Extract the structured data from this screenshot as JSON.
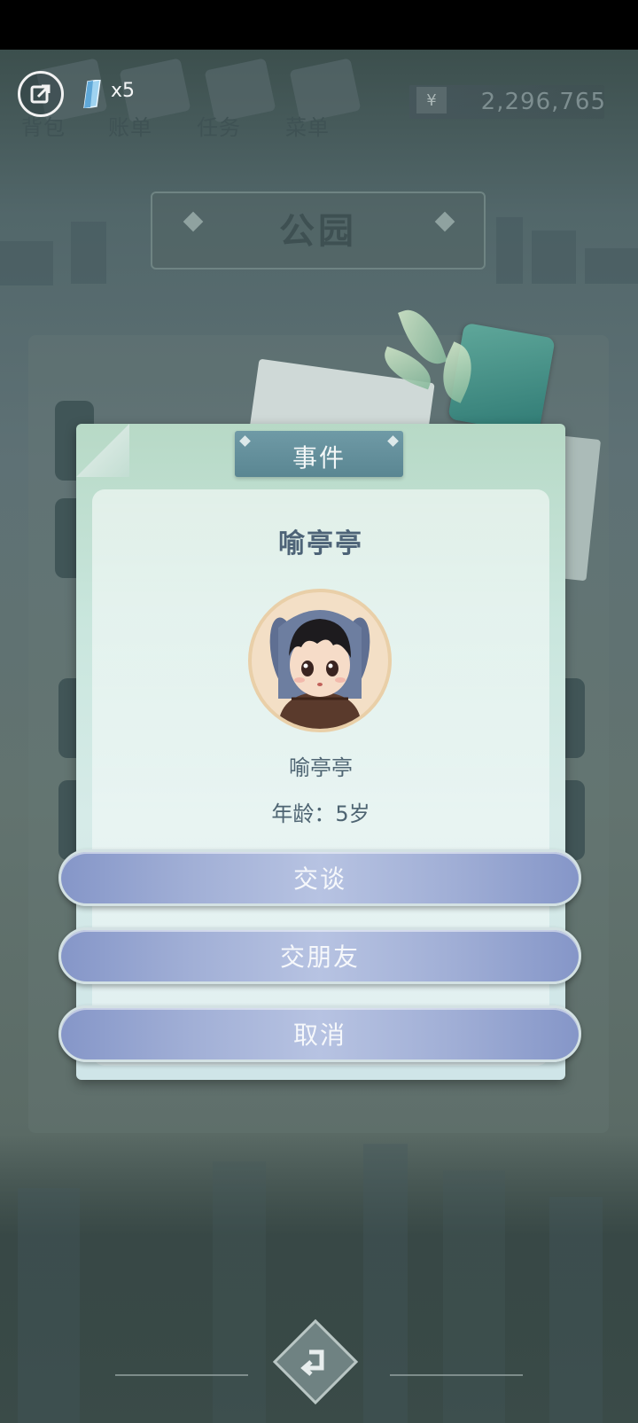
{
  "hud": {
    "tabs": [
      {
        "label": "背包",
        "icon": "backpack-icon"
      },
      {
        "label": "账单",
        "icon": "bill-icon"
      },
      {
        "label": "任务",
        "icon": "task-icon"
      },
      {
        "label": "菜单",
        "icon": "menu-icon"
      }
    ],
    "gem_count": "x5",
    "currency_symbol": "¥",
    "money": "2,296,765"
  },
  "location": {
    "title": "公园"
  },
  "dialog": {
    "header": "事件",
    "npc_name_title": "喻亭亭",
    "npc_name": "喻亭亭",
    "age_label": "年龄：",
    "age_value": "5岁"
  },
  "actions": [
    {
      "label": "交谈"
    },
    {
      "label": "交朋友"
    },
    {
      "label": "取消"
    }
  ],
  "colors": {
    "button_fill": "#a1afd6",
    "dialog_bg": "#c9e6dd",
    "title_text": "#4d6377"
  }
}
